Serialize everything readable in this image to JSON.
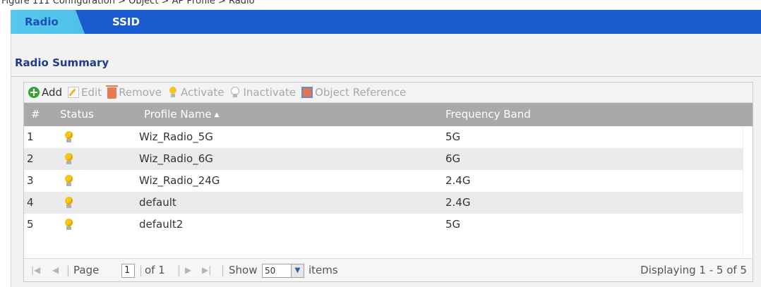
{
  "caption": "Figure 111  Configuration > Object > AP Profile > Radio",
  "tabs": [
    {
      "label": "Radio",
      "active": true
    },
    {
      "label": "SSID",
      "active": false
    }
  ],
  "section_title": "Radio Summary",
  "toolbar": {
    "add": "Add",
    "edit": "Edit",
    "remove": "Remove",
    "activate": "Activate",
    "inactivate": "Inactivate",
    "object_reference": "Object Reference"
  },
  "columns": {
    "index": "#",
    "status": "Status",
    "profile_name": "Profile Name",
    "frequency_band": "Frequency Band"
  },
  "rows": [
    {
      "index": "1",
      "status_icon": "lightbulb-on-icon",
      "profile_name": "Wiz_Radio_5G",
      "frequency_band": "5G"
    },
    {
      "index": "2",
      "status_icon": "lightbulb-on-icon",
      "profile_name": "Wiz_Radio_6G",
      "frequency_band": "6G"
    },
    {
      "index": "3",
      "status_icon": "lightbulb-on-icon",
      "profile_name": "Wiz_Radio_24G",
      "frequency_band": "2.4G"
    },
    {
      "index": "4",
      "status_icon": "lightbulb-on-icon",
      "profile_name": "default",
      "frequency_band": "2.4G"
    },
    {
      "index": "5",
      "status_icon": "lightbulb-on-icon",
      "profile_name": "default2",
      "frequency_band": "5G"
    }
  ],
  "pager": {
    "page_label": "Page",
    "page_value": "1",
    "of_label": "of 1",
    "show_label": "Show",
    "show_value": "50",
    "items_label": "items",
    "displaying": "Displaying 1 - 5 of 5"
  },
  "colors": {
    "tab_bar": "#1a5bd0",
    "active_tab": "#4fc0ea",
    "header_bg": "#a9a9a9",
    "title_text": "#1e3c8c"
  }
}
